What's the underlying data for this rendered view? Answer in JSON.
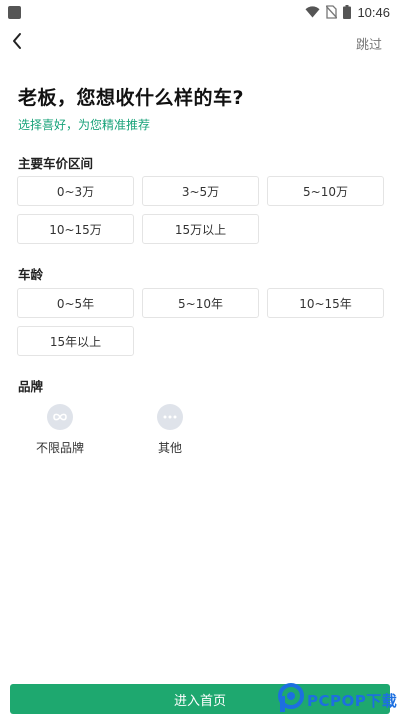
{
  "status_bar": {
    "time": "10:46"
  },
  "nav": {
    "back_icon": "chevron-left-icon",
    "skip_label": "跳过"
  },
  "header": {
    "title": "老板，您想收什么样的车?",
    "subtitle": "选择喜好，为您精准推荐"
  },
  "price_section": {
    "label": "主要车价区间",
    "options": [
      "0~3万",
      "3~5万",
      "5~10万",
      "10~15万",
      "15万以上"
    ]
  },
  "age_section": {
    "label": "车龄",
    "options": [
      "0~5年",
      "5~10年",
      "10~15年",
      "15年以上"
    ]
  },
  "brand_section": {
    "label": "品牌",
    "items": [
      {
        "label": "不限品牌",
        "icon": "infinity-icon"
      },
      {
        "label": "其他",
        "icon": "more-dots-icon"
      }
    ]
  },
  "footer": {
    "enter_label": "进入首页"
  },
  "watermark": {
    "text": "PCPOP下载"
  },
  "colors": {
    "accent": "#1ea86f",
    "subtitle": "#19a37a",
    "watermark": "#1d6fe0"
  }
}
